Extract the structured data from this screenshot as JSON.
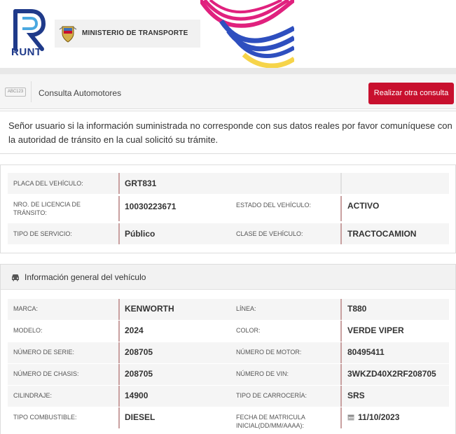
{
  "header": {
    "brand": "RUNT",
    "ministry": "MINISTERIO DE TRANSPORTE"
  },
  "toolbar": {
    "icon": "abc123-plate-icon",
    "icon_text": "ABC123",
    "title": "Consulta Automotores",
    "new_query_label": "Realizar otra consulta",
    "accent_color": "#c8102e"
  },
  "notice": "Señor usuario si la información suministrada no corresponde con sus datos reales por favor comuníquese con la autoridad de tránsito en la cual solicitó su trámite.",
  "summary": {
    "placa_label": "PLACA DEL VEHÍCULO:",
    "placa_value": "GRT831",
    "licencia_label": "NRO. DE LICENCIA DE TRÁNSITO:",
    "licencia_value": "10030223671",
    "estado_label": "ESTADO DEL VEHÍCULO:",
    "estado_value": "ACTIVO",
    "servicio_label": "TIPO DE SERVICIO:",
    "servicio_value": "Público",
    "clase_label": "CLASE DE VEHÍCULO:",
    "clase_value": "TRACTOCAMION"
  },
  "general": {
    "title": "Información general del vehículo",
    "icon": "car-icon",
    "fields": [
      {
        "label": "MARCA:",
        "value": "KENWORTH"
      },
      {
        "label": "LÍNEA:",
        "value": "T880"
      },
      {
        "label": "MODELO:",
        "value": "2024"
      },
      {
        "label": "COLOR:",
        "value": "VERDE VIPER"
      },
      {
        "label": "NÚMERO DE SERIE:",
        "value": "208705"
      },
      {
        "label": "NÚMERO DE MOTOR:",
        "value": "80495411"
      },
      {
        "label": "NÚMERO DE CHASIS:",
        "value": "208705"
      },
      {
        "label": "NÚMERO DE VIN:",
        "value": "3WKZD40X2RF208705"
      },
      {
        "label": "CILINDRAJE:",
        "value": "14900"
      },
      {
        "label": "TIPO DE CARROCERÍA:",
        "value": "SRS"
      },
      {
        "label": "TIPO COMBUSTIBLE:",
        "value": "DIESEL"
      },
      {
        "label": "FECHA DE MATRICULA INICIAL(DD/MM/AAAA):",
        "value": "11/10/2023"
      }
    ]
  }
}
